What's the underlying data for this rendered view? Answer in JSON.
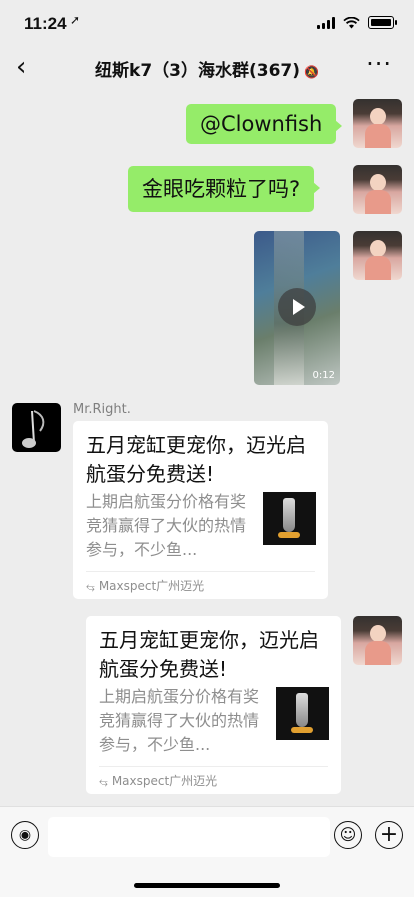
{
  "status_bar": {
    "time": "11:24"
  },
  "header": {
    "title": "纽斯k7（3）海水群(367)"
  },
  "messages": {
    "m1_text": "@Clownfish",
    "m2_text": "金眼吃颗粒了吗?",
    "video_duration": "0:12",
    "sender_name": "Mr.Right.",
    "card1": {
      "title": "五月宠缸更宠你，迈光启航蛋分免费送!",
      "desc": "上期启航蛋分价格有奖竞猜赢得了大伙的热情参与，不少鱼...",
      "source": "Maxspect广州迈光"
    },
    "card2": {
      "title": "五月宠缸更宠你，迈光启航蛋分免费送!",
      "desc": "上期启航蛋分价格有奖竞猜赢得了大伙的热情参与，不少鱼...",
      "source": "Maxspect广州迈光"
    }
  },
  "colors": {
    "bubble": "#95ec69",
    "background": "#ededed"
  }
}
